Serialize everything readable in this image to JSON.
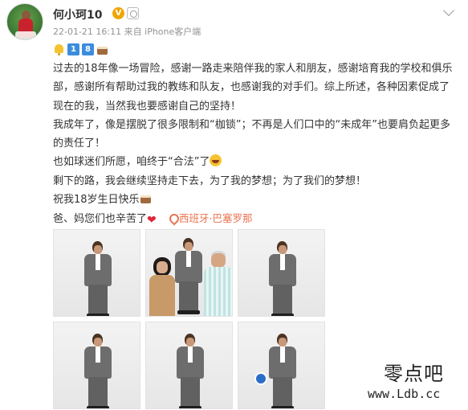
{
  "post": {
    "author": {
      "name": "何小珂10",
      "verified_badge": "V"
    },
    "meta": {
      "datetime": "22-01-21 16:11",
      "source_prefix": "来自",
      "source": "iPhone客户端"
    },
    "emoji_row": {
      "num1": "1",
      "num2": "8"
    },
    "paragraphs": [
      "过去的18年像一场冒险，感谢一路走来陪伴我的家人和朋友，感谢培育我的学校和俱乐部，感谢所有帮助过我的教练和队友，也感谢我的对手们。综上所述，各种因素促成了现在的我，当然我也要感谢自己的坚持！",
      "我成年了，像是摆脱了很多限制和“枷锁”；不再是人们口中的“未成年”也要肩负起更多的责任了！",
      "也如球迷们所愿，咱终于“合法”了",
      "剩下的路，我会继续坚持走下去，为了我的梦想；为了我们的梦想！",
      "祝我18岁生日快乐",
      "爸、妈您们也辛苦了"
    ],
    "location": "西班牙·巴塞罗那",
    "photos": [
      {
        "label": "photo-1"
      },
      {
        "label": "photo-2"
      },
      {
        "label": "photo-3"
      },
      {
        "label": "photo-4"
      },
      {
        "label": "photo-5"
      },
      {
        "label": "photo-6"
      }
    ]
  },
  "watermark": {
    "text": "零点吧",
    "url": "www.Ldb.cc"
  },
  "colors": {
    "text": "#333333",
    "meta": "#939393",
    "location": "#eb7350",
    "badge": "#f0a500",
    "number_box": "#3b8ddc"
  }
}
